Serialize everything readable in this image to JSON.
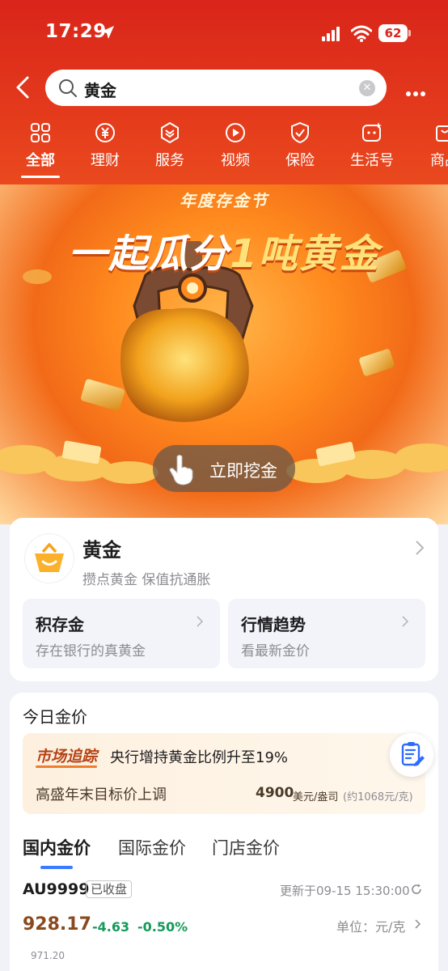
{
  "status_bar": {
    "time": "17:29",
    "battery": "62"
  },
  "search": {
    "query": "黄金"
  },
  "categories": [
    {
      "label": "全部",
      "icon": "grid-icon",
      "active": true
    },
    {
      "label": "理财",
      "icon": "yen-icon"
    },
    {
      "label": "服务",
      "icon": "service-icon"
    },
    {
      "label": "视频",
      "icon": "play-icon"
    },
    {
      "label": "保险",
      "icon": "shield-icon"
    },
    {
      "label": "生活号",
      "icon": "life-account-icon"
    },
    {
      "label": "商品",
      "icon": "shop-icon"
    }
  ],
  "banner": {
    "subtitle": "年度存金节",
    "title_prefix": "一起瓜分",
    "title_highlight": "1吨黄金",
    "cta": "立即挖金"
  },
  "gold_card": {
    "title": "黄金",
    "subtitle": "攒点黄金 保值抗通胀",
    "tiles": [
      {
        "title": "积存金",
        "subtitle": "存在银行的真黄金"
      },
      {
        "title": "行情趋势",
        "subtitle": "看最新金价"
      }
    ]
  },
  "price_card": {
    "heading": "今日金价",
    "news": {
      "tag": "市场追踪",
      "headline": "央行增持黄金比例升至19%",
      "line2": "高盛年末目标价上调",
      "value": "4900",
      "value_unit": "美元/盎司",
      "equivalent": "(约1068元/克)"
    },
    "tabs": [
      "国内金价",
      "国际金价",
      "门店金价"
    ],
    "active_tab": 0,
    "quote": {
      "code": "AU9999",
      "status": "已收盘",
      "updated": "更新于09-15 15:30:00",
      "price": "928.17",
      "change": "-4.63",
      "change_pct": "-0.50%",
      "unit_label": "单位：元/克",
      "axis_top": "971.20"
    }
  },
  "colors": {
    "brand_red": "#d9251a",
    "gold": "#ffb64a",
    "down_green": "#159a5a",
    "accent_blue": "#3a7bff"
  }
}
